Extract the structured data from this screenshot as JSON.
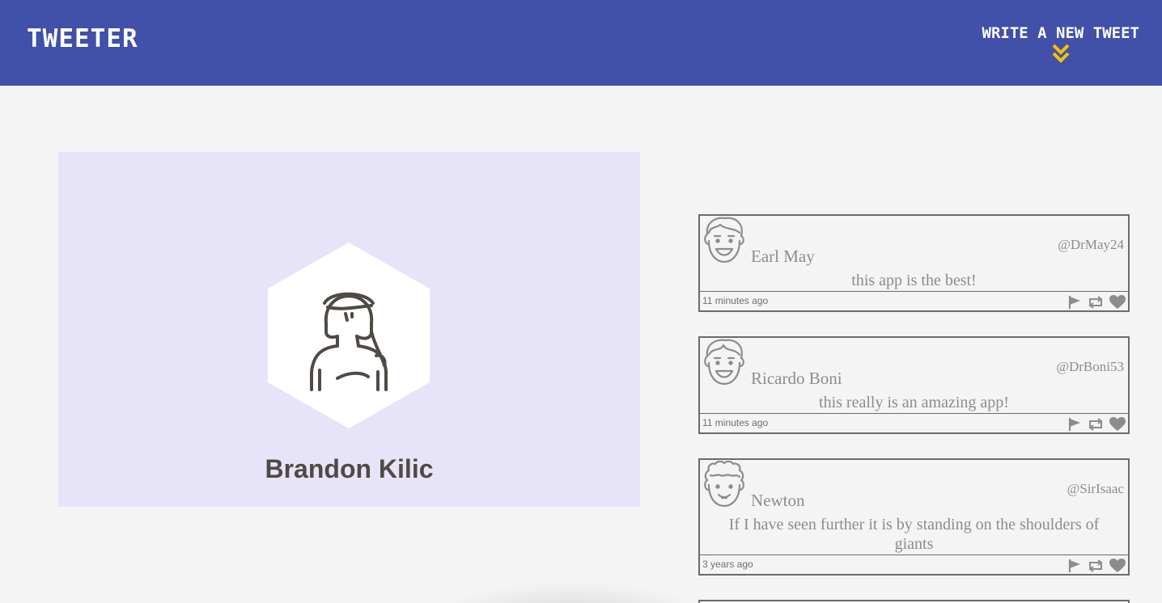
{
  "header": {
    "brand": "TWEETER",
    "compose_label": "WRITE A NEW TWEET",
    "compose_icon": "double-chevron-down-icon",
    "colors": {
      "bar": "#4150a8",
      "accent": "#f5c400",
      "text": "#ffffff"
    }
  },
  "profile": {
    "name": "Brandon Kilic",
    "avatar_icon": "woman-avatar-icon",
    "colors": {
      "panel": "#e7e4fa"
    }
  },
  "tweets": [
    {
      "name": "Earl May",
      "handle": "@DrMay24",
      "text": "this app is the best!",
      "time": "11 minutes ago",
      "avatar_icon": "smiling-man-avatar-icon"
    },
    {
      "name": "Ricardo Boni",
      "handle": "@DrBoni53",
      "text": "this really is an amazing app!",
      "time": "11 minutes ago",
      "avatar_icon": "smiling-man-avatar-icon"
    },
    {
      "name": "Newton",
      "handle": "@SirIsaac",
      "text": "If I have seen further it is by standing on the shoulders of giants",
      "time": "3 years ago",
      "avatar_icon": "curly-hair-man-avatar-icon"
    }
  ],
  "tweet_actions": [
    "flag-icon",
    "retweet-icon",
    "heart-icon"
  ]
}
